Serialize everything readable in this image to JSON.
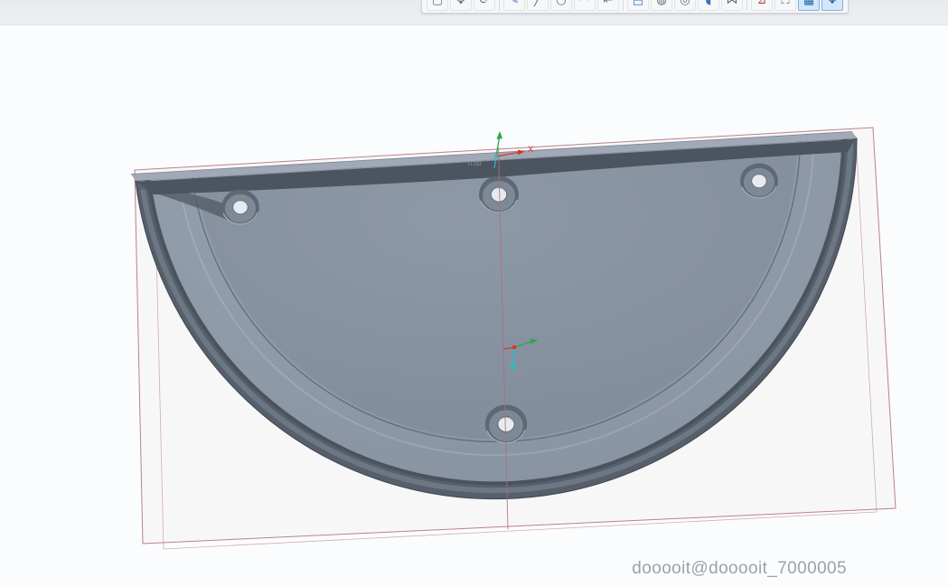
{
  "window": {
    "top_strip_color": "#e8eaed",
    "viewport_background": "#fbfcfd"
  },
  "toolbar": {
    "icons": [
      {
        "name": "select-tool",
        "glyph": "▢",
        "color": "#5d6c7e"
      },
      {
        "name": "pan-tool",
        "glyph": "✥",
        "color": "#5d6c7e"
      },
      {
        "name": "rotate-view-tool",
        "glyph": "⟳",
        "color": "#5d6c7e",
        "divider_after": true
      },
      {
        "name": "sketch-tool",
        "glyph": "✎",
        "color": "#3c72b8"
      },
      {
        "name": "line-tool",
        "glyph": "╱",
        "color": "#5d6c7e"
      },
      {
        "name": "circle-tool",
        "glyph": "○",
        "color": "#5d6c7e"
      },
      {
        "name": "arc-tool",
        "glyph": "◠",
        "color": "#b08f35"
      },
      {
        "name": "dimension-tool",
        "glyph": "⇤",
        "color": "#5d6c7e",
        "divider_after": true
      },
      {
        "name": "extrude-feature",
        "glyph": "⬒",
        "color": "#3c72b8"
      },
      {
        "name": "revolve-feature",
        "glyph": "◍",
        "color": "#5d6c7e"
      },
      {
        "name": "hole-feature",
        "glyph": "◎",
        "color": "#5d6c7e"
      },
      {
        "name": "fillet-feature",
        "glyph": "◖",
        "color": "#3c72b8"
      },
      {
        "name": "mirror-feature",
        "glyph": "⋈",
        "color": "#5d6c7e",
        "divider_after": true
      },
      {
        "name": "measure-tool",
        "glyph": "⊿",
        "color": "#a04848"
      },
      {
        "name": "zoom-fit",
        "glyph": "⛶",
        "color": "#5d6c7e"
      },
      {
        "name": "view-style-toggle",
        "glyph": "▦",
        "color": "#1f5fa8",
        "active": true
      },
      {
        "name": "display-mode-toggle",
        "glyph": "❖",
        "color": "#1f5fa8",
        "active": true
      }
    ]
  },
  "viewport": {
    "watermark": "dooooit@dooooit_7000005",
    "axis_x_label": "X",
    "origin_coordinate_label": "0.00"
  },
  "colors": {
    "wall": "#565f6a",
    "lip": "#4c545f",
    "rimtop": "#a0a9b5",
    "face": "#909baa",
    "panel": "#87929f",
    "sketch": "#b06b7b",
    "axisX": "#e03131",
    "axisY": "#2ea44f",
    "axisZ": "#22bfd2",
    "watermark": "#9ca1a7"
  }
}
